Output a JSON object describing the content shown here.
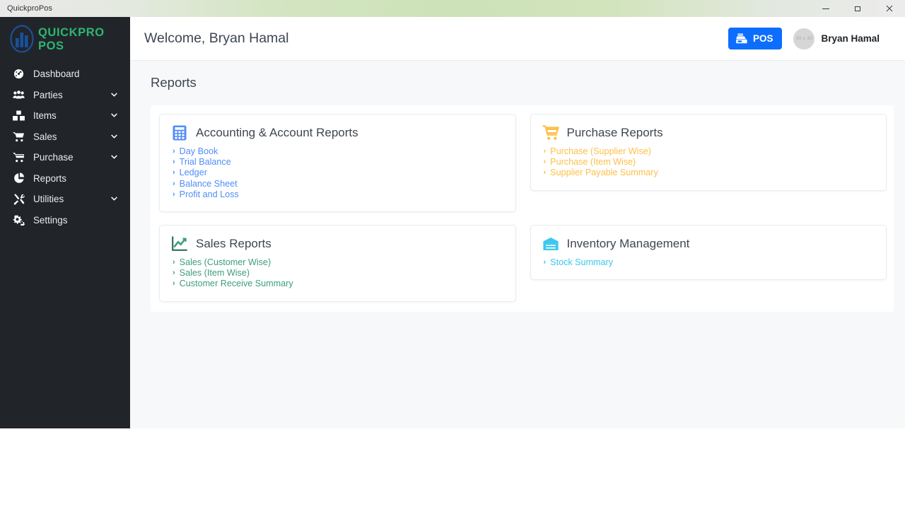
{
  "window": {
    "title": "QuickproPos",
    "controls": [
      {
        "name": "minimize",
        "glyph": "minimize-icon"
      },
      {
        "name": "maximize",
        "glyph": "restore-icon"
      },
      {
        "name": "close",
        "glyph": "close-icon"
      }
    ]
  },
  "sidebar": {
    "brand": {
      "text": "QUICKPRO POS",
      "icon": "quickpro-logo-icon"
    },
    "items": [
      {
        "label": "Dashboard",
        "icon": "dashboard-icon",
        "expandable": false
      },
      {
        "label": "Parties",
        "icon": "users-icon",
        "expandable": true
      },
      {
        "label": "Items",
        "icon": "boxes-icon",
        "expandable": true
      },
      {
        "label": "Sales",
        "icon": "cart-icon",
        "expandable": true
      },
      {
        "label": "Purchase",
        "icon": "cart-alt-icon",
        "expandable": true
      },
      {
        "label": "Reports",
        "icon": "pie-chart-icon",
        "expandable": false
      },
      {
        "label": "Utilities",
        "icon": "tools-icon",
        "expandable": true
      },
      {
        "label": "Settings",
        "icon": "cogs-icon",
        "expandable": false
      }
    ]
  },
  "topbar": {
    "welcome": "Welcome, Bryan Hamal",
    "pos_button": {
      "label": "POS",
      "icon": "cash-register-icon"
    },
    "avatar_placeholder": "30 x 30",
    "user_name": "Bryan Hamal"
  },
  "page": {
    "title": "Reports",
    "cards": [
      {
        "title": "Accounting & Account Reports",
        "icon": "calculator-icon",
        "accent": "#4f8ef7",
        "links": [
          "Day Book",
          "Trial Balance",
          "Ledger",
          "Balance Sheet",
          "Profit and Loss"
        ]
      },
      {
        "title": "Purchase Reports",
        "icon": "shopping-cart-icon",
        "accent": "#fcbf49",
        "links": [
          "Purchase (Supplier Wise)",
          "Purchase (Item Wise)",
          "Supplier Payable Summary"
        ]
      },
      {
        "title": "Sales Reports",
        "icon": "chart-line-icon",
        "accent": "#3e9d7e",
        "links": [
          "Sales (Customer Wise)",
          "Sales (Item Wise)",
          "Customer Receive Summary"
        ]
      },
      {
        "title": "Inventory Management",
        "icon": "warehouse-icon",
        "accent": "#3ac8f0",
        "links": [
          "Stock Summary"
        ]
      }
    ]
  },
  "chevron_glyph": "›"
}
